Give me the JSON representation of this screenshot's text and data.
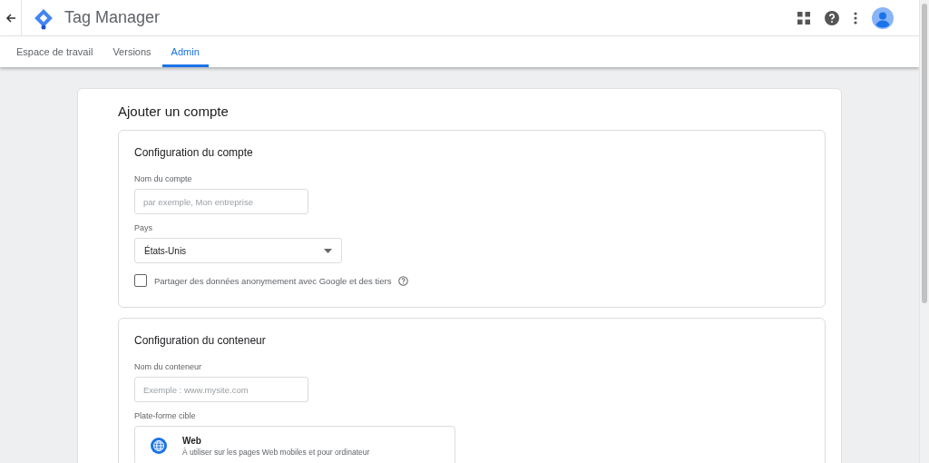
{
  "app_bar": {
    "title": "Tag Manager"
  },
  "tabs": [
    {
      "label": "Espace de travail",
      "selected": false
    },
    {
      "label": "Versions",
      "selected": false
    },
    {
      "label": "Admin",
      "selected": true
    }
  ],
  "page_title": "Ajouter un compte",
  "account_section": {
    "title": "Configuration du compte",
    "name_label": "Nom du compte",
    "name_placeholder": "par exemple, Mon entreprise",
    "country_label": "Pays",
    "country_value": "États-Unis",
    "share_checkbox": {
      "label": "Partager des données anonymement avec Google et des tiers",
      "checked": false
    }
  },
  "container_section": {
    "title": "Configuration du conteneur",
    "name_label": "Nom du conteneur",
    "name_placeholder": "Exemple : www.mysite.com",
    "platform_label": "Plate-forme cible",
    "platforms": [
      {
        "title": "Web",
        "description": "À utiliser sur les pages Web mobiles et pour ordinateur"
      }
    ]
  }
}
